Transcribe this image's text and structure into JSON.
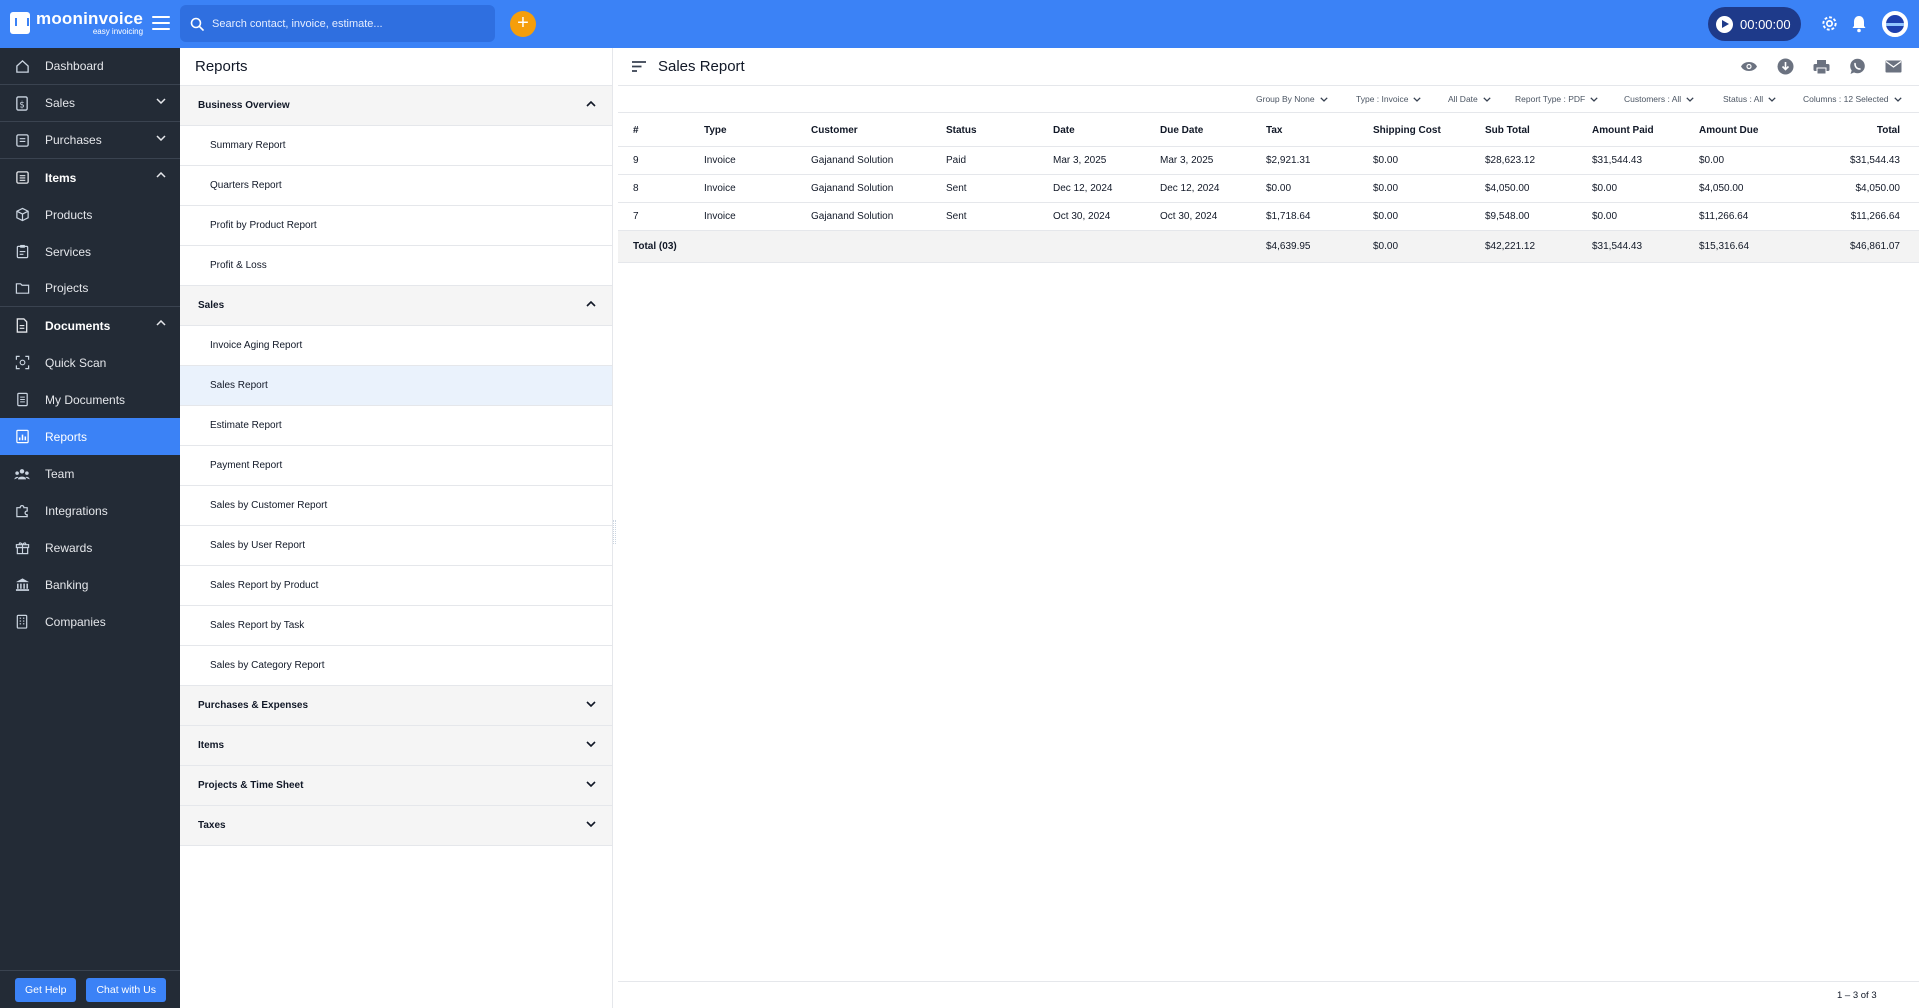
{
  "app": {
    "name": "mooninvoice",
    "tagline": "easy invoicing",
    "search_placeholder": "Search contact, invoice, estimate...",
    "timer": "00:00:00"
  },
  "nav": {
    "items": [
      {
        "label": "Dashboard",
        "icon": "home-icon"
      },
      {
        "label": "Sales",
        "icon": "dollar-doc-icon"
      },
      {
        "label": "Purchases",
        "icon": "cart-icon"
      },
      {
        "label": "Items",
        "icon": "list-icon"
      },
      {
        "label": "Products",
        "icon": "box-icon"
      },
      {
        "label": "Services",
        "icon": "services-icon"
      },
      {
        "label": "Projects",
        "icon": "folder-icon"
      },
      {
        "label": "Documents",
        "icon": "document-icon"
      },
      {
        "label": "Quick Scan",
        "icon": "scan-icon"
      },
      {
        "label": "My Documents",
        "icon": "documents-icon"
      },
      {
        "label": "Reports",
        "icon": "report-icon"
      },
      {
        "label": "Team",
        "icon": "team-icon"
      },
      {
        "label": "Integrations",
        "icon": "puzzle-icon"
      },
      {
        "label": "Rewards",
        "icon": "gift-icon"
      },
      {
        "label": "Banking",
        "icon": "bank-icon"
      },
      {
        "label": "Companies",
        "icon": "building-icon"
      }
    ],
    "help_label": "Get Help",
    "chat_label": "Chat with Us"
  },
  "reports_menu": {
    "title": "Reports",
    "business_overview": {
      "label": "Business Overview",
      "items": [
        "Summary Report",
        "Quarters Report",
        "Profit by Product Report",
        "Profit & Loss"
      ]
    },
    "sales": {
      "label": "Sales",
      "items": [
        "Invoice Aging Report",
        "Sales Report",
        "Estimate Report",
        "Payment Report",
        "Sales by Customer Report",
        "Sales by User Report",
        "Sales Report by Product",
        "Sales Report by Task",
        "Sales by Category Report"
      ]
    },
    "collapsed": [
      "Purchases & Expenses",
      "Items",
      "Projects & Time Sheet",
      "Taxes"
    ]
  },
  "report": {
    "title": "Sales Report",
    "filters": [
      "Group By None",
      "Type : Invoice",
      "All Date",
      "Report Type : PDF",
      "Customers : All",
      "Status : All",
      "Columns : 12 Selected"
    ],
    "columns": [
      "#",
      "Type",
      "Customer",
      "Status",
      "Date",
      "Due Date",
      "Tax",
      "Shipping Cost",
      "Sub Total",
      "Amount Paid",
      "Amount Due",
      "Total"
    ],
    "rows": [
      [
        "9",
        "Invoice",
        "Gajanand Solution",
        "Paid",
        "Mar 3, 2025",
        "Mar 3, 2025",
        "$2,921.31",
        "$0.00",
        "$28,623.12",
        "$31,544.43",
        "$0.00",
        "$31,544.43"
      ],
      [
        "8",
        "Invoice",
        "Gajanand Solution",
        "Sent",
        "Dec 12, 2024",
        "Dec 12, 2024",
        "$0.00",
        "$0.00",
        "$4,050.00",
        "$0.00",
        "$4,050.00",
        "$4,050.00"
      ],
      [
        "7",
        "Invoice",
        "Gajanand Solution",
        "Sent",
        "Oct 30, 2024",
        "Oct 30, 2024",
        "$1,718.64",
        "$0.00",
        "$9,548.00",
        "$0.00",
        "$11,266.64",
        "$11,266.64"
      ]
    ],
    "totals": {
      "label": "Total (03)",
      "tax": "$4,639.95",
      "shipping": "$0.00",
      "sub_total": "$42,221.12",
      "amount_paid": "$31,544.43",
      "amount_due": "$15,316.64",
      "total": "$46,861.07"
    },
    "pagination": "1 – 3 of 3"
  },
  "colors": {
    "primary": "#3b82f6",
    "sidebar": "#232b36",
    "accent": "#f59e0b",
    "timer": "#1e3a8a"
  }
}
